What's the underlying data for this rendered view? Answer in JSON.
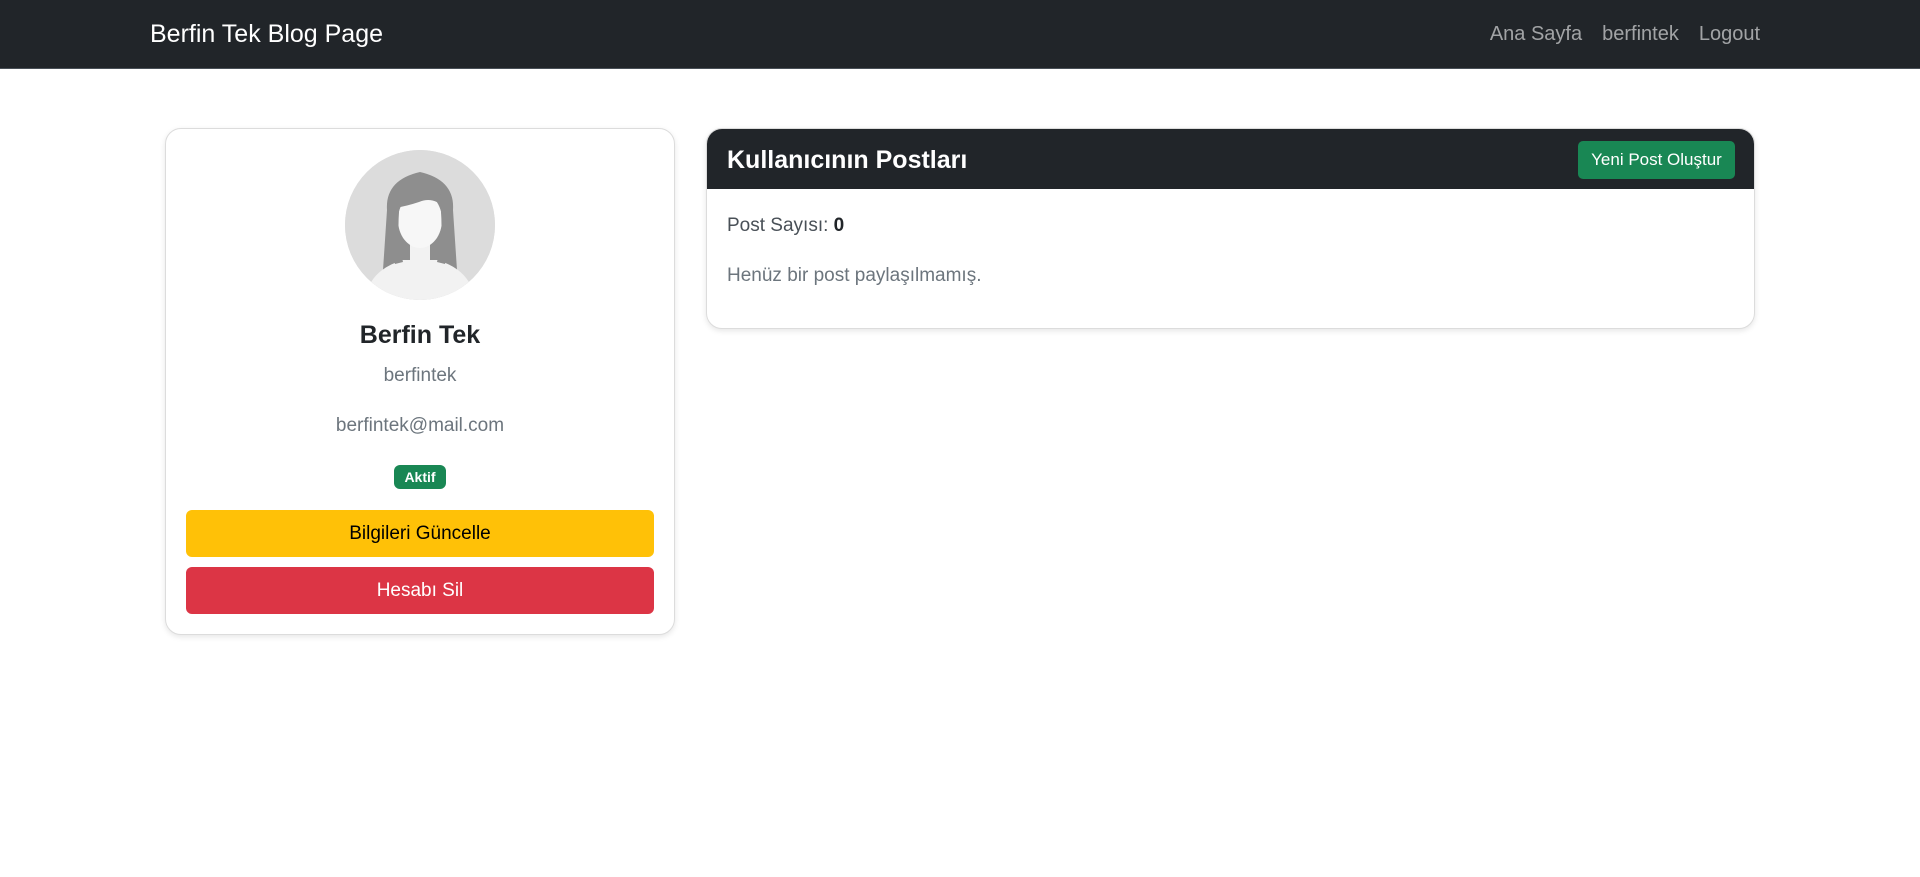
{
  "navbar": {
    "brand": "Berfin Tek Blog Page",
    "links": [
      "Ana Sayfa",
      "berfintek",
      "Logout"
    ]
  },
  "profile": {
    "avatar_icon": "user-avatar-icon",
    "name": "Berfin Tek",
    "username": "berfintek",
    "email": "berfintek@mail.com",
    "status_badge": "Aktif",
    "update_button": "Bilgileri Güncelle",
    "delete_button": "Hesabı Sil"
  },
  "posts": {
    "title": "Kullanıcının Postları",
    "new_post_button": "Yeni Post Oluştur",
    "count_label": "Post Sayısı:",
    "count_value": "0",
    "empty_message": "Henüz bir post paylaşılmamış."
  },
  "colors": {
    "navbar_bg": "#212529",
    "success": "#198754",
    "warning": "#ffc107",
    "danger": "#dc3545"
  }
}
